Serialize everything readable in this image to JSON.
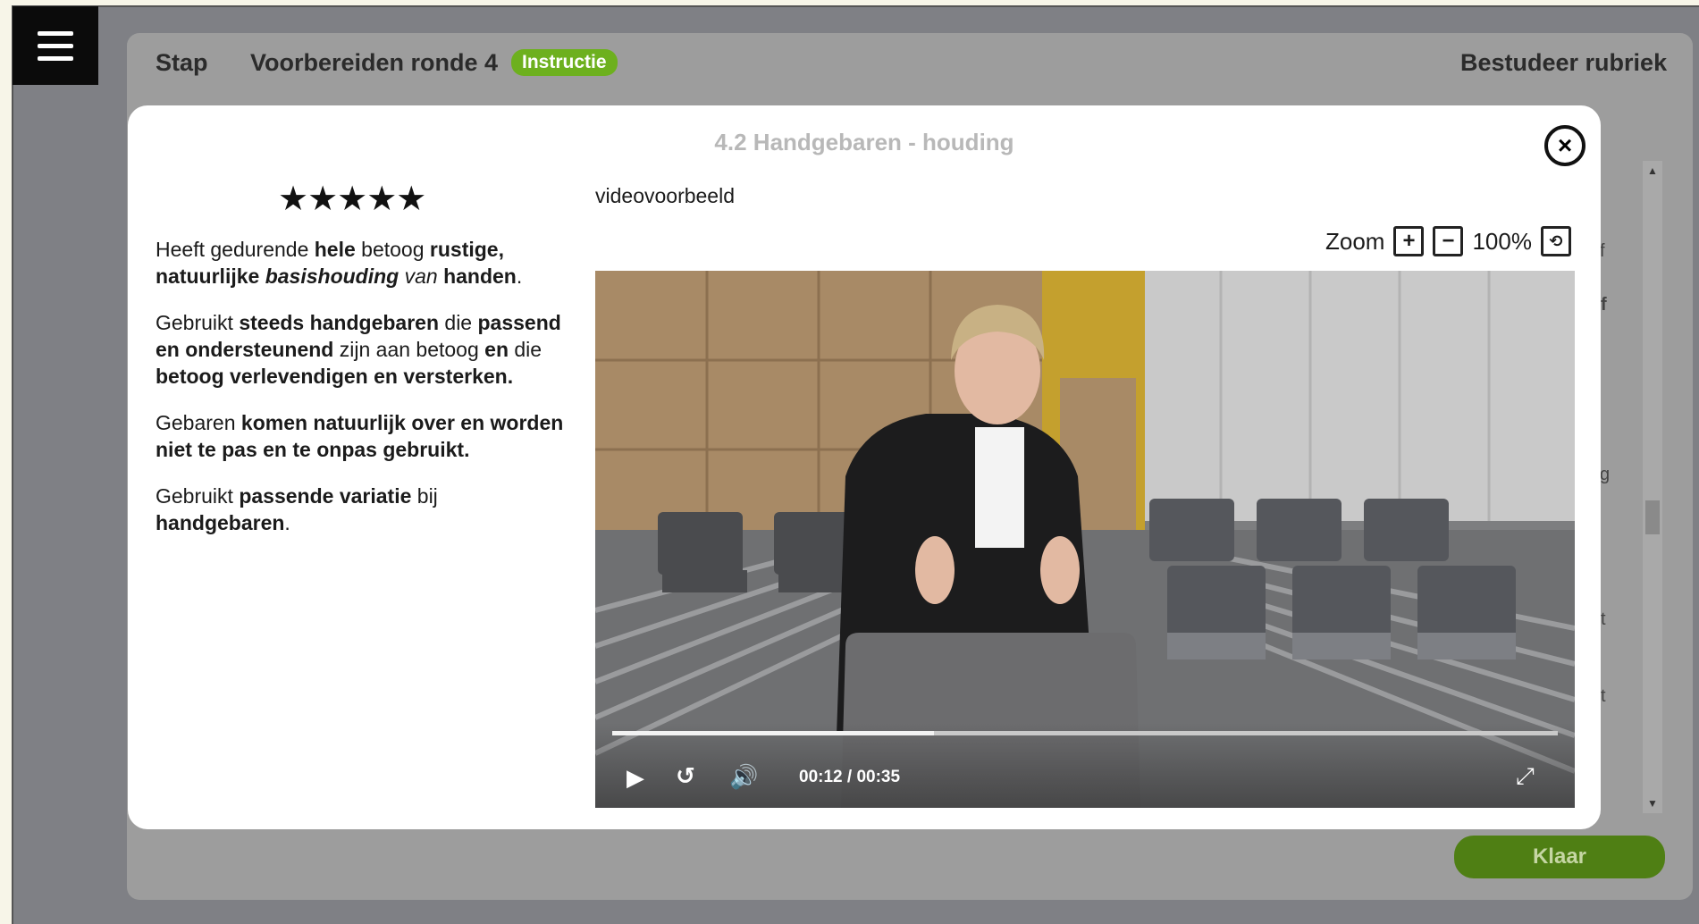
{
  "menu": {
    "icon": "hamburger-menu-icon"
  },
  "header": {
    "step_label": "Stap",
    "round_title": "Voorbereiden ronde 4",
    "badge": "Instructie",
    "right_link": "Bestudeer rubriek"
  },
  "background_fragments": [
    "f",
    "f",
    "g",
    "t",
    "t"
  ],
  "footer": {
    "done_label": "Klaar"
  },
  "modal": {
    "title": "4.2 Handgebaren - houding",
    "close_icon": "close-circle-icon",
    "rating": {
      "stars": 5,
      "max": 5,
      "glyphs": "★★★★★"
    },
    "video_label": "videovoorbeeld",
    "zoom": {
      "label": "Zoom",
      "value": "100%",
      "plus_icon": "zoom-in-icon",
      "minus_icon": "zoom-out-icon",
      "reset_icon": "zoom-reset-icon"
    },
    "video": {
      "current": "00:12",
      "total": "00:35",
      "progress": 0.34,
      "play_icon": "play-icon",
      "rewind_icon": "rewind-10-icon",
      "volume_icon": "volume-icon",
      "fullscreen_icon": "fullscreen-icon"
    }
  },
  "colors": {
    "accent_green": "#6db01e",
    "done_button": "#4f7f14",
    "overlay": "#9d9d9d"
  }
}
